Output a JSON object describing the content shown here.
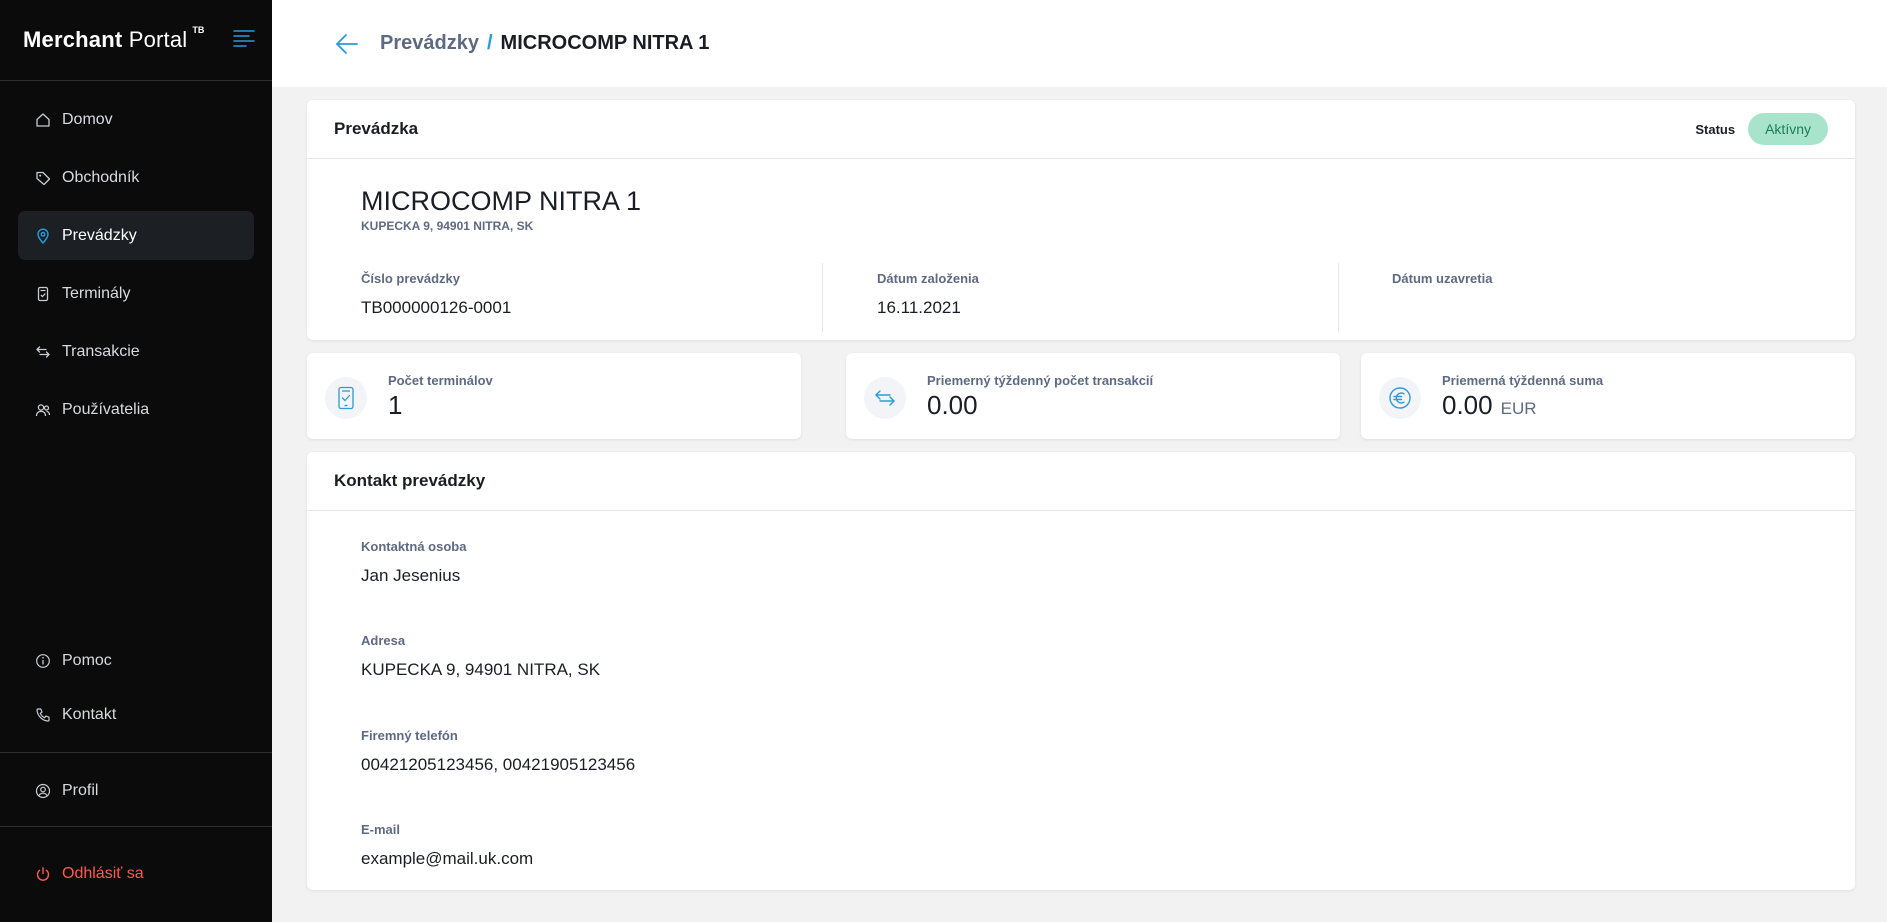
{
  "app": {
    "brand_bold": "Merchant",
    "brand_light": "Portal",
    "brand_sup": "TB"
  },
  "sidebar": {
    "items": [
      {
        "label": "Domov",
        "icon": "home-icon"
      },
      {
        "label": "Obchodník",
        "icon": "tag-icon"
      },
      {
        "label": "Prevádzky",
        "icon": "location-pin-icon",
        "active": true
      },
      {
        "label": "Terminály",
        "icon": "terminal-icon"
      },
      {
        "label": "Transakcie",
        "icon": "arrows-exchange-icon"
      },
      {
        "label": "Používatelia",
        "icon": "users-icon"
      }
    ],
    "bottom_items": [
      {
        "label": "Pomoc",
        "icon": "info-icon"
      },
      {
        "label": "Kontakt",
        "icon": "phone-icon"
      }
    ],
    "profile": {
      "label": "Profil",
      "icon": "user-circle-icon"
    },
    "logout": {
      "label": "Odhlásiť sa",
      "icon": "power-icon",
      "color": "#ff5a4e"
    }
  },
  "header": {
    "breadcrumb_parent": "Prevádzky",
    "breadcrumb_sep": "/",
    "breadcrumb_current": "MICROCOMP NITRA 1"
  },
  "shop_card": {
    "title": "Prevádzka",
    "status_label": "Status",
    "status_value": "Aktívny",
    "name": "MICROCOMP NITRA 1",
    "address": "KUPECKA 9, 94901 NITRA, SK",
    "fields": [
      {
        "label": "Číslo prevádzky",
        "value": "TB000000126-0001"
      },
      {
        "label": "Dátum založenia",
        "value": "16.11.2021"
      },
      {
        "label": "Dátum uzavretia",
        "value": ""
      }
    ]
  },
  "stats": [
    {
      "label": "Počet terminálov",
      "value": "1",
      "unit": "",
      "icon": "terminal-check-icon"
    },
    {
      "label": "Priemerný týždenný počet transakcií",
      "value": "0.00",
      "unit": "",
      "icon": "arrows-exchange-icon"
    },
    {
      "label": "Priemerná týždenná suma",
      "value": "0.00",
      "unit": "EUR",
      "icon": "euro-icon"
    }
  ],
  "contact_card": {
    "title": "Kontakt prevádzky",
    "fields": [
      {
        "label": "Kontaktná osoba",
        "value": "Jan Jesenius"
      },
      {
        "label": "Adresa",
        "value": "KUPECKA 9, 94901 NITRA, SK"
      },
      {
        "label": "Firemný telefón",
        "value": "00421205123456, 00421905123456"
      },
      {
        "label": "E-mail",
        "value": "example@mail.uk.com"
      }
    ]
  },
  "colors": {
    "accent": "#2a9bd8",
    "sidebar_bg": "#0b0b0c",
    "status_bg": "#a8e4cc",
    "status_text": "#1b7e58"
  }
}
